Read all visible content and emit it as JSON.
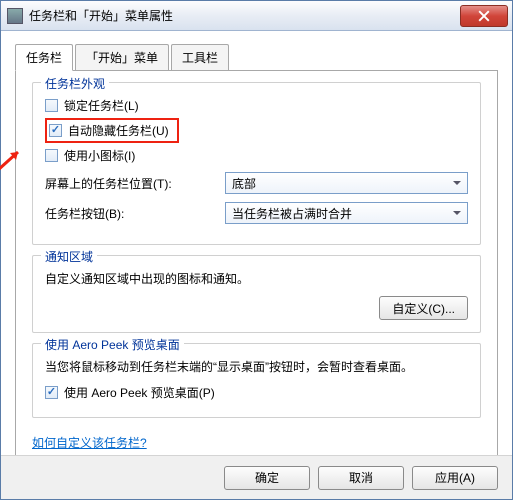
{
  "window": {
    "title": "任务栏和「开始」菜单属性"
  },
  "tabs": [
    {
      "label": "任务栏",
      "active": true
    },
    {
      "label": "「开始」菜单",
      "active": false
    },
    {
      "label": "工具栏",
      "active": false
    }
  ],
  "appearance": {
    "title": "任务栏外观",
    "lock": {
      "label": "锁定任务栏(L)",
      "checked": false
    },
    "autohide": {
      "label": "自动隐藏任务栏(U)",
      "checked": true
    },
    "smallicons": {
      "label": "使用小图标(I)",
      "checked": false
    },
    "position": {
      "label": "屏幕上的任务栏位置(T):",
      "value": "底部"
    },
    "buttons": {
      "label": "任务栏按钮(B):",
      "value": "当任务栏被占满时合并"
    }
  },
  "notification": {
    "title": "通知区域",
    "desc": "自定义通知区域中出现的图标和通知。",
    "customize": "自定义(C)..."
  },
  "aero": {
    "title": "使用 Aero Peek 预览桌面",
    "desc": "当您将鼠标移动到任务栏末端的“显示桌面”按钮时，会暂时查看桌面。",
    "checkbox": {
      "label": "使用 Aero Peek 预览桌面(P)",
      "checked": true
    }
  },
  "help_link": "如何自定义该任务栏?",
  "footer": {
    "ok": "确定",
    "cancel": "取消",
    "apply": "应用(A)"
  }
}
